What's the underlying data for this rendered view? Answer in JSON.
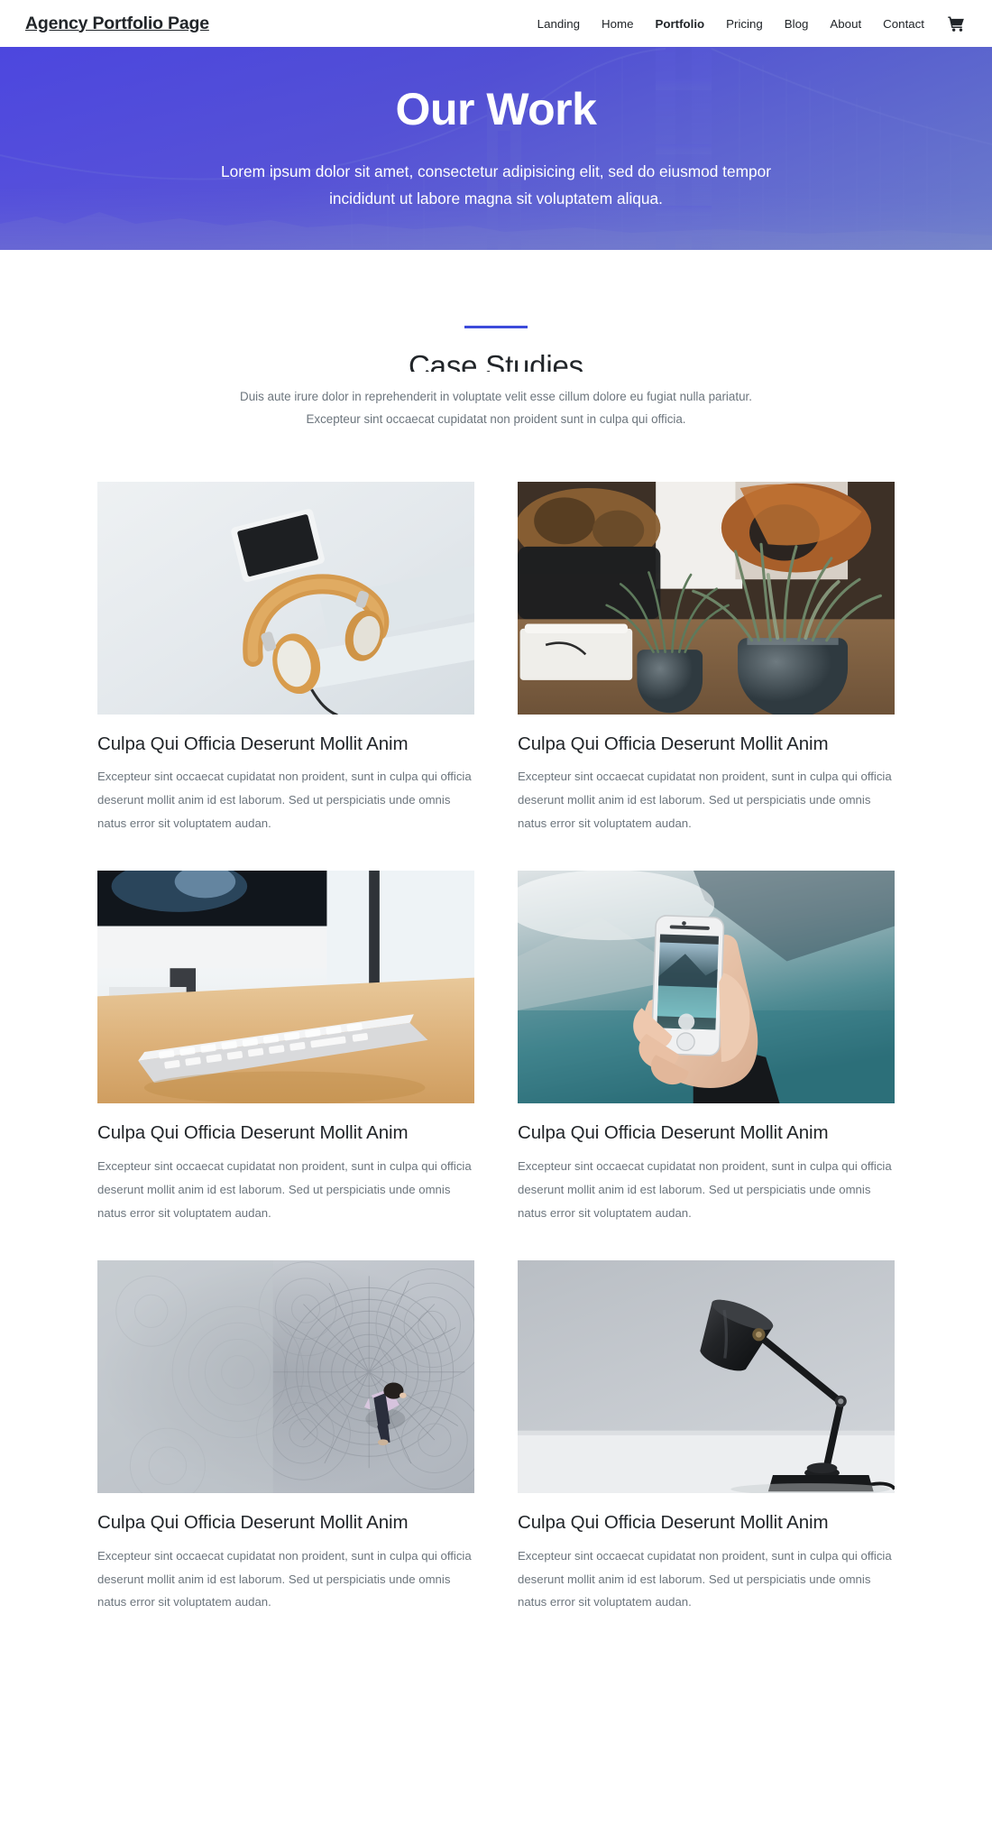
{
  "header": {
    "brand": "Agency Portfolio Page",
    "nav": [
      {
        "label": "Landing",
        "active": false
      },
      {
        "label": "Home",
        "active": false
      },
      {
        "label": "Portfolio",
        "active": true
      },
      {
        "label": "Pricing",
        "active": false
      },
      {
        "label": "Blog",
        "active": false
      },
      {
        "label": "About",
        "active": false
      },
      {
        "label": "Contact",
        "active": false
      }
    ],
    "cart_icon": "shopping-cart-icon"
  },
  "hero": {
    "title": "Our Work",
    "subtitle": "Lorem ipsum dolor sit amet, consectetur adipisicing elit, sed do eiusmod tempor incididunt ut labore magna sit voluptatem aliqua.",
    "background_image": "golden-gate-bridge-photo",
    "overlay_color": "#453ce1",
    "text_color": "#ffffff"
  },
  "section": {
    "rule_color": "#3c4bdb",
    "title": "Case Studies",
    "description": "Duis aute irure dolor in reprehenderit in voluptate velit esse cillum dolore eu fugiat nulla pariatur. Excepteur sint occaecat cupidatat non proident sunt in culpa qui officia."
  },
  "cards": [
    {
      "image": "headphones-and-phone-on-white-desk-photo",
      "title": "Culpa Qui Officia Deserunt Mollit Anim",
      "text": "Excepteur sint occaecat cupidatat non proident, sunt in culpa qui officia deserunt mollit anim id est laborum. Sed ut perspiciatis unde omnis natus error sit voluptatem audan."
    },
    {
      "image": "potted-plants-on-wooden-table-photo",
      "title": "Culpa Qui Officia Deserunt Mollit Anim",
      "text": "Excepteur sint occaecat cupidatat non proident, sunt in culpa qui officia deserunt mollit anim id est laborum. Sed ut perspiciatis unde omnis natus error sit voluptatem audan."
    },
    {
      "image": "keyboard-and-monitor-on-desk-photo",
      "title": "Culpa Qui Officia Deserunt Mollit Anim",
      "text": "Excepteur sint occaecat cupidatat non proident, sunt in culpa qui officia deserunt mollit anim id est laborum. Sed ut perspiciatis unde omnis natus error sit voluptatem audan."
    },
    {
      "image": "hand-holding-phone-photographing-lake-photo",
      "title": "Culpa Qui Officia Deserunt Mollit Anim",
      "text": "Excepteur sint occaecat cupidatat non proident, sunt in culpa qui officia deserunt mollit anim id est laborum. Sed ut perspiciatis unde omnis natus error sit voluptatem audan."
    },
    {
      "image": "aerial-person-walking-on-patterned-pavement-photo",
      "title": "Culpa Qui Officia Deserunt Mollit Anim",
      "text": "Excepteur sint occaecat cupidatat non proident, sunt in culpa qui officia deserunt mollit anim id est laborum. Sed ut perspiciatis unde omnis natus error sit voluptatem audan."
    },
    {
      "image": "black-desk-lamp-against-grey-wall-photo",
      "title": "Culpa Qui Officia Deserunt Mollit Anim",
      "text": "Excepteur sint occaecat cupidatat non proident, sunt in culpa qui officia deserunt mollit anim id est laborum. Sed ut perspiciatis unde omnis natus error sit voluptatem audan."
    }
  ]
}
